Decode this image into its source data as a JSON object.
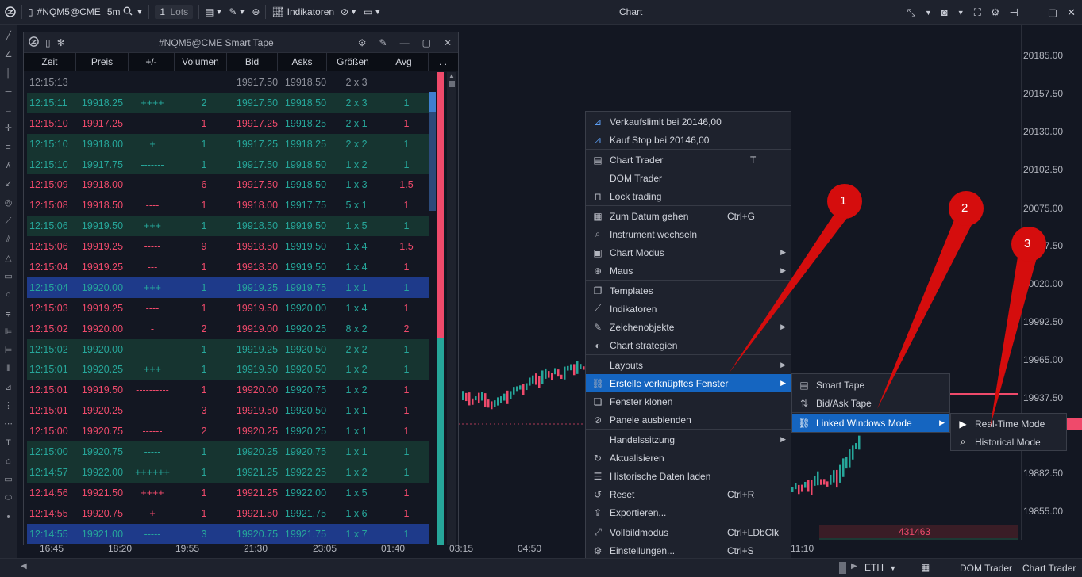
{
  "topbar": {
    "symbol": "#NQM5@CME",
    "timeframe": "5m",
    "lots_value": "1",
    "lots_label": "Lots",
    "indicators_label": "Indikatoren",
    "chart_title": "Chart"
  },
  "price_axis": [
    "20185.00",
    "20157.50",
    "20130.00",
    "20102.50",
    "20075.00",
    "20047.50",
    "20020.00",
    "19992.50",
    "19965.00",
    "19937.50",
    "19882.50",
    "19855.00"
  ],
  "time_axis": [
    "16:45",
    "18:20",
    "19:55",
    "21:30",
    "23:05",
    "01:40",
    "03:15",
    "04:50",
    "11:10"
  ],
  "volume_label": "431463",
  "bottombar": {
    "session": "ETH",
    "dom_trader": "DOM Trader",
    "chart_trader": "Chart Trader"
  },
  "tape": {
    "title": "#NQM5@CME Smart Tape",
    "headers": [
      "Zeit",
      "Preis",
      "+/-",
      "Volumen",
      "Bid",
      "Asks",
      "Größen",
      "Avg",
      ". ."
    ],
    "rows": [
      {
        "zeit": "12:15:13",
        "preis": "",
        "pm": "",
        "vol": "",
        "bid": "19917.50",
        "ask": "19918.50",
        "gr": "2 x 3",
        "avg": "",
        "kind": "neutral"
      },
      {
        "zeit": "12:15:11",
        "preis": "19918.25",
        "pm": "++++",
        "vol": "2",
        "bid": "19917.50",
        "ask": "19918.50",
        "gr": "2 x 3",
        "avg": "1",
        "kind": "buy"
      },
      {
        "zeit": "12:15:10",
        "preis": "19917.25",
        "pm": "---",
        "vol": "1",
        "bid": "19917.25",
        "ask": "19918.25",
        "gr": "2 x 1",
        "avg": "1",
        "kind": "sell"
      },
      {
        "zeit": "12:15:10",
        "preis": "19918.00",
        "pm": "+",
        "vol": "1",
        "bid": "19917.25",
        "ask": "19918.25",
        "gr": "2 x 2",
        "avg": "1",
        "kind": "buy"
      },
      {
        "zeit": "12:15:10",
        "preis": "19917.75",
        "pm": "-------",
        "vol": "1",
        "bid": "19917.50",
        "ask": "19918.50",
        "gr": "1 x 2",
        "avg": "1",
        "kind": "buy"
      },
      {
        "zeit": "12:15:09",
        "preis": "19918.00",
        "pm": "-------",
        "vol": "6",
        "bid": "19917.50",
        "ask": "19918.50",
        "gr": "1 x 3",
        "avg": "1.5",
        "kind": "sell"
      },
      {
        "zeit": "12:15:08",
        "preis": "19918.50",
        "pm": "----",
        "vol": "1",
        "bid": "19918.00",
        "ask": "19917.75",
        "gr": "5 x 1",
        "avg": "1",
        "kind": "sell"
      },
      {
        "zeit": "12:15:06",
        "preis": "19919.50",
        "pm": "+++",
        "vol": "1",
        "bid": "19918.50",
        "ask": "19919.50",
        "gr": "1 x 5",
        "avg": "1",
        "kind": "buy"
      },
      {
        "zeit": "12:15:06",
        "preis": "19919.25",
        "pm": "-----",
        "vol": "9",
        "bid": "19918.50",
        "ask": "19919.50",
        "gr": "1 x 4",
        "avg": "1.5",
        "kind": "sell"
      },
      {
        "zeit": "12:15:04",
        "preis": "19919.25",
        "pm": "---",
        "vol": "1",
        "bid": "19918.50",
        "ask": "19919.50",
        "gr": "1 x 4",
        "avg": "1",
        "kind": "sell"
      },
      {
        "zeit": "12:15:04",
        "preis": "19920.00",
        "pm": "+++",
        "vol": "1",
        "bid": "19919.25",
        "ask": "19919.75",
        "gr": "1 x 1",
        "avg": "1",
        "kind": "hl"
      },
      {
        "zeit": "12:15:03",
        "preis": "19919.25",
        "pm": "----",
        "vol": "1",
        "bid": "19919.50",
        "ask": "19920.00",
        "gr": "1 x 4",
        "avg": "1",
        "kind": "sell"
      },
      {
        "zeit": "12:15:02",
        "preis": "19920.00",
        "pm": "-",
        "vol": "2",
        "bid": "19919.00",
        "ask": "19920.25",
        "gr": "8 x 2",
        "avg": "2",
        "kind": "sell"
      },
      {
        "zeit": "12:15:02",
        "preis": "19920.00",
        "pm": "-",
        "vol": "1",
        "bid": "19919.25",
        "ask": "19920.50",
        "gr": "2 x 2",
        "avg": "1",
        "kind": "buy"
      },
      {
        "zeit": "12:15:01",
        "preis": "19920.25",
        "pm": "+++",
        "vol": "1",
        "bid": "19919.50",
        "ask": "19920.50",
        "gr": "1 x 2",
        "avg": "1",
        "kind": "buy"
      },
      {
        "zeit": "12:15:01",
        "preis": "19919.50",
        "pm": "----------",
        "vol": "1",
        "bid": "19920.00",
        "ask": "19920.75",
        "gr": "1 x 2",
        "avg": "1",
        "kind": "sell"
      },
      {
        "zeit": "12:15:01",
        "preis": "19920.25",
        "pm": "---------",
        "vol": "3",
        "bid": "19919.50",
        "ask": "19920.50",
        "gr": "1 x 1",
        "avg": "1",
        "kind": "sell"
      },
      {
        "zeit": "12:15:00",
        "preis": "19920.75",
        "pm": "------",
        "vol": "2",
        "bid": "19920.25",
        "ask": "19920.25",
        "gr": "1 x 1",
        "avg": "1",
        "kind": "sell"
      },
      {
        "zeit": "12:15:00",
        "preis": "19920.75",
        "pm": "-----",
        "vol": "1",
        "bid": "19920.25",
        "ask": "19920.75",
        "gr": "1 x 1",
        "avg": "1",
        "kind": "buy"
      },
      {
        "zeit": "12:14:57",
        "preis": "19922.00",
        "pm": "++++++",
        "vol": "1",
        "bid": "19921.25",
        "ask": "19922.25",
        "gr": "1 x 2",
        "avg": "1",
        "kind": "buy"
      },
      {
        "zeit": "12:14:56",
        "preis": "19921.50",
        "pm": "++++",
        "vol": "1",
        "bid": "19921.25",
        "ask": "19922.00",
        "gr": "1 x 5",
        "avg": "1",
        "kind": "sell"
      },
      {
        "zeit": "12:14:55",
        "preis": "19920.75",
        "pm": "+",
        "vol": "1",
        "bid": "19921.50",
        "ask": "19921.75",
        "gr": "1 x 6",
        "avg": "1",
        "kind": "sell"
      },
      {
        "zeit": "12:14:55",
        "preis": "19921.00",
        "pm": "-----",
        "vol": "3",
        "bid": "19920.75",
        "ask": "19921.75",
        "gr": "1 x 7",
        "avg": "1",
        "kind": "hl"
      }
    ]
  },
  "menu": {
    "items": [
      {
        "icon": "sell-limit-icon",
        "label": "Verkaufslimit bei 20146,00",
        "shortcut": "",
        "arrow": false
      },
      {
        "icon": "buy-stop-icon",
        "label": "Kauf Stop bei 20146,00",
        "shortcut": "",
        "arrow": false
      },
      {
        "icon": "chart-trader-icon",
        "label": "Chart Trader",
        "shortcut": "T",
        "arrow": false
      },
      {
        "icon": "",
        "label": "DOM Trader",
        "shortcut": "",
        "arrow": false
      },
      {
        "icon": "lock-icon",
        "label": "Lock trading",
        "shortcut": "",
        "arrow": false
      },
      {
        "icon": "calendar-icon",
        "label": "Zum Datum gehen",
        "shortcut": "Ctrl+G",
        "arrow": false
      },
      {
        "icon": "search-icon",
        "label": "Instrument wechseln",
        "shortcut": "",
        "arrow": false
      },
      {
        "icon": "chart-mode-icon",
        "label": "Chart Modus",
        "shortcut": "",
        "arrow": true
      },
      {
        "icon": "crosshair-icon",
        "label": "Maus",
        "shortcut": "",
        "arrow": true
      },
      {
        "icon": "templates-icon",
        "label": "Templates",
        "shortcut": "",
        "arrow": false
      },
      {
        "icon": "indicators-icon",
        "label": "Indikatoren",
        "shortcut": "",
        "arrow": false
      },
      {
        "icon": "pencil-icon",
        "label": "Zeichenobjekte",
        "shortcut": "",
        "arrow": true
      },
      {
        "icon": "strategy-icon",
        "label": "Chart strategien",
        "shortcut": "",
        "arrow": false
      },
      {
        "icon": "",
        "label": "Layouts",
        "shortcut": "",
        "arrow": true
      },
      {
        "icon": "link-icon",
        "label": "Erstelle verknüpftes Fenster",
        "shortcut": "",
        "arrow": true
      },
      {
        "icon": "clone-icon",
        "label": "Fenster klonen",
        "shortcut": "",
        "arrow": false
      },
      {
        "icon": "hide-icon",
        "label": "Panele ausblenden",
        "shortcut": "",
        "arrow": false
      },
      {
        "icon": "",
        "label": "Handelssitzung",
        "shortcut": "",
        "arrow": true
      },
      {
        "icon": "refresh-icon",
        "label": "Aktualisieren",
        "shortcut": "",
        "arrow": false
      },
      {
        "icon": "database-icon",
        "label": "Historische Daten laden",
        "shortcut": "",
        "arrow": false
      },
      {
        "icon": "reset-icon",
        "label": "Reset",
        "shortcut": "Ctrl+R",
        "arrow": false
      },
      {
        "icon": "export-icon",
        "label": "Exportieren...",
        "shortcut": "",
        "arrow": false
      },
      {
        "icon": "fullscreen-icon",
        "label": "Vollbildmodus",
        "shortcut": "Ctrl+LDbClk",
        "arrow": false
      },
      {
        "icon": "gear-icon",
        "label": "Einstellungen...",
        "shortcut": "Ctrl+S",
        "arrow": false
      }
    ]
  },
  "submenu1": {
    "items": [
      {
        "icon": "tape-icon",
        "label": "Smart Tape"
      },
      {
        "icon": "bid-ask-icon",
        "label": "Bid/Ask Tape"
      },
      {
        "icon": "link-icon",
        "label": "Linked Windows Mode"
      }
    ]
  },
  "submenu2": {
    "items": [
      {
        "icon": "play-icon",
        "label": "Real-Time Mode"
      },
      {
        "icon": "historical-icon",
        "label": "Historical Mode"
      }
    ]
  },
  "callouts": [
    "1",
    "2",
    "3"
  ],
  "colors": {
    "buy": "#26a69a",
    "sell": "#ef4a6b",
    "accent": "#1565c0",
    "callout": "#d50d0d"
  }
}
